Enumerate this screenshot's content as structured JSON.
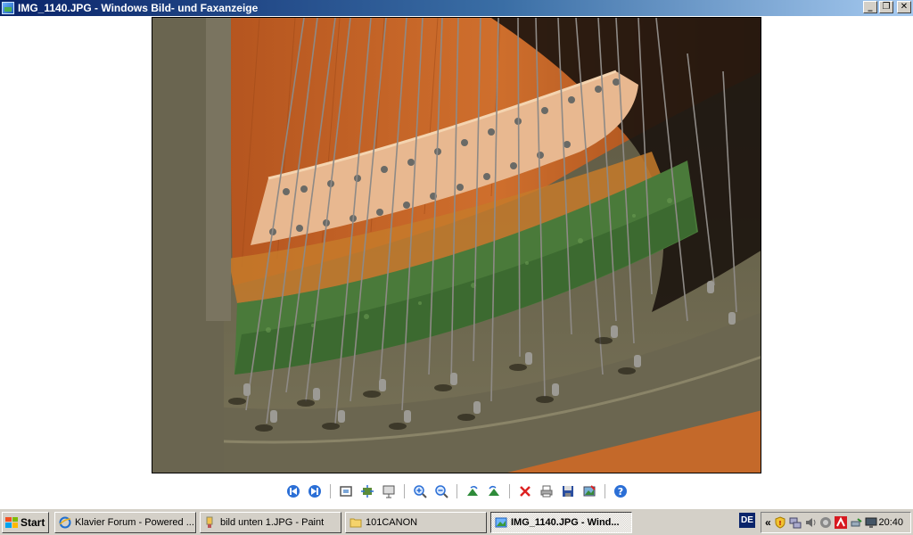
{
  "window": {
    "title": "IMG_1140.JPG - Windows Bild- und Faxanzeige",
    "icon": "image-viewer-icon",
    "buttons": [
      "minimize-icon",
      "restore-icon",
      "close-icon"
    ]
  },
  "toolbar": {
    "buttons": [
      {
        "name": "previous-image-button",
        "icon": "previous-icon"
      },
      {
        "name": "next-image-button",
        "icon": "next-icon"
      },
      {
        "name": "best-fit-button",
        "icon": "best-fit-icon"
      },
      {
        "name": "actual-size-button",
        "icon": "actual-size-icon"
      },
      {
        "name": "slideshow-button",
        "icon": "slideshow-icon"
      },
      {
        "name": "zoom-in-button",
        "icon": "zoom-in-icon"
      },
      {
        "name": "zoom-out-button",
        "icon": "zoom-out-icon"
      },
      {
        "name": "rotate-clockwise-button",
        "icon": "rotate-cw-icon"
      },
      {
        "name": "rotate-counterclockwise-button",
        "icon": "rotate-ccw-icon"
      },
      {
        "name": "delete-button",
        "icon": "delete-icon"
      },
      {
        "name": "print-button",
        "icon": "print-icon"
      },
      {
        "name": "save-button",
        "icon": "save-icon"
      },
      {
        "name": "edit-button",
        "icon": "edit-icon"
      },
      {
        "name": "help-button",
        "icon": "help-icon"
      }
    ]
  },
  "taskbar": {
    "start_label": "Start",
    "tasks": [
      {
        "label": "Klavier Forum - Powered ...",
        "icon": "ie-icon",
        "active": false
      },
      {
        "label": "bild unten 1.JPG - Paint",
        "icon": "paint-icon",
        "active": false
      },
      {
        "label": "101CANON",
        "icon": "folder-icon",
        "active": false
      },
      {
        "label": "IMG_1140.JPG - Wind...",
        "icon": "image-viewer-icon",
        "active": true
      }
    ],
    "language": "DE",
    "tray_expand": "«",
    "tray_icons": [
      "security-shield-icon",
      "network-icon",
      "speaker-icon",
      "antivirus-icon",
      "safely-remove-icon",
      "display-icon"
    ],
    "clock": "20:40"
  },
  "colors": {
    "title_active": "#0a246a",
    "title_gradient_end": "#a6caf0",
    "face": "#d4d0c8"
  }
}
